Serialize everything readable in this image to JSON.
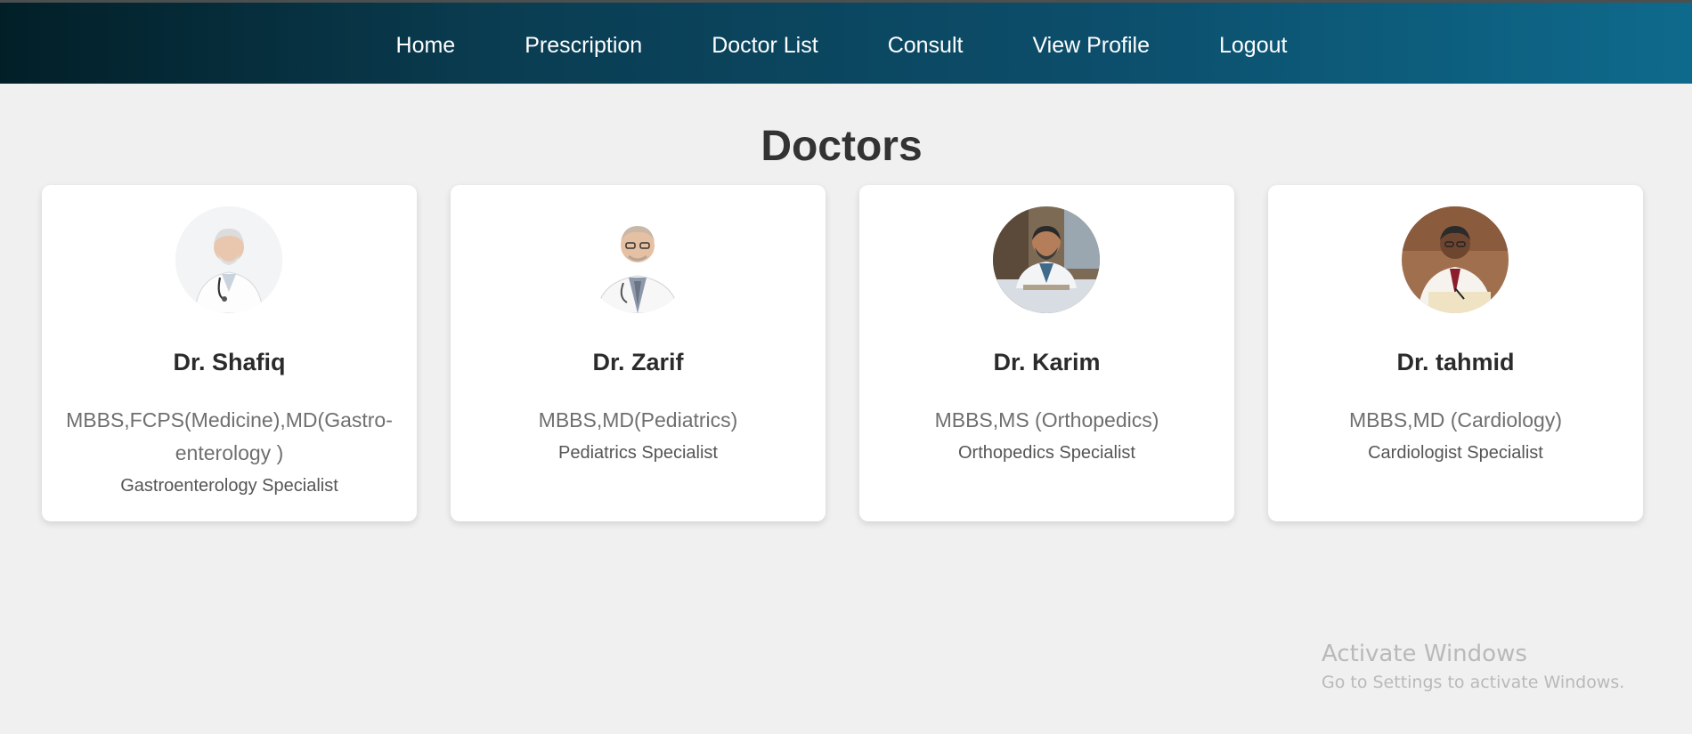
{
  "nav": {
    "items": [
      {
        "label": "Home"
      },
      {
        "label": "Prescription"
      },
      {
        "label": "Doctor List"
      },
      {
        "label": "Consult"
      },
      {
        "label": "View Profile"
      },
      {
        "label": "Logout"
      }
    ]
  },
  "main": {
    "title": "Doctors",
    "doctors": [
      {
        "name": "Dr. Shafiq",
        "degree": "MBBS,FCPS(Medicine),MD(Gastro-enterology )",
        "specialty": "Gastroenterology Specialist",
        "photo_icon": "doctor-photo-1"
      },
      {
        "name": "Dr. Zarif",
        "degree": "MBBS,MD(Pediatrics)",
        "specialty": "Pediatrics Specialist",
        "photo_icon": "doctor-photo-2"
      },
      {
        "name": "Dr. Karim",
        "degree": "MBBS,MS (Orthopedics)",
        "specialty": "Orthopedics Specialist",
        "photo_icon": "doctor-photo-3"
      },
      {
        "name": "Dr. tahmid",
        "degree": "MBBS,MD (Cardiology)",
        "specialty": "Cardiologist Specialist",
        "photo_icon": "doctor-photo-4"
      }
    ]
  },
  "watermark": {
    "title": "Activate Windows",
    "subtitle": "Go to Settings to activate Windows."
  },
  "colors": {
    "nav_gradient_start": "#021f27",
    "nav_gradient_end": "#0e6a8c",
    "page_background": "#f0f0f0",
    "card_background": "#ffffff"
  }
}
